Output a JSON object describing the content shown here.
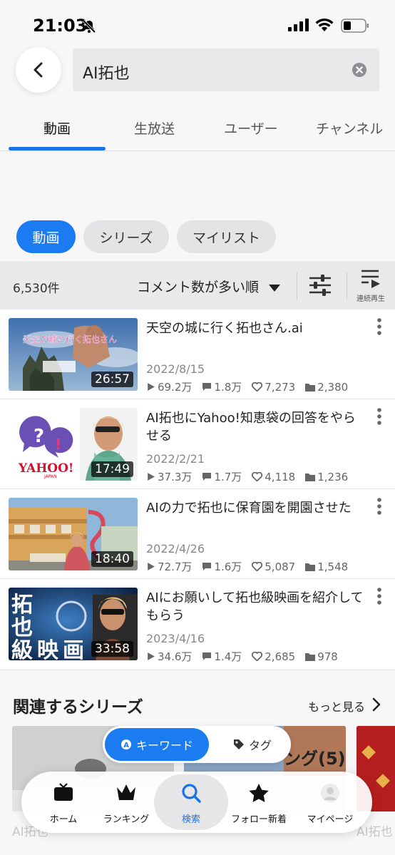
{
  "status_bar": {
    "time": "21:03"
  },
  "search": {
    "query": "AI拓也"
  },
  "tabs": [
    {
      "label": "動画",
      "active": true
    },
    {
      "label": "生放送",
      "active": false
    },
    {
      "label": "ユーザー",
      "active": false
    },
    {
      "label": "チャンネル",
      "active": false
    }
  ],
  "filter_chips": [
    {
      "label": "動画",
      "active": true
    },
    {
      "label": "シリーズ",
      "active": false
    },
    {
      "label": "マイリスト",
      "active": false
    }
  ],
  "sort_bar": {
    "count": "6,530件",
    "sort_label": "コメント数が多い順",
    "continuous_label": "連続再生"
  },
  "videos": [
    {
      "title": "天空の城に行く拓也さん.ai",
      "date": "2022/8/15",
      "duration": "26:57",
      "views": "69.2万",
      "comments": "1.8万",
      "likes": "7,273",
      "mylists": "2,380"
    },
    {
      "title": "AI拓也にYahoo!知恵袋の回答をやらせる",
      "date": "2022/2/21",
      "duration": "17:49",
      "views": "37.3万",
      "comments": "1.7万",
      "likes": "4,118",
      "mylists": "1,236"
    },
    {
      "title": "AIの力で拓也に保育園を開園させた",
      "date": "2022/4/26",
      "duration": "18:40",
      "views": "72.7万",
      "comments": "1.6万",
      "likes": "5,087",
      "mylists": "1,548"
    },
    {
      "title": "AIにお願いして拓也級映画を紹介してもらう",
      "date": "2023/4/16",
      "duration": "33:58",
      "views": "34.6万",
      "comments": "1.4万",
      "likes": "2,685",
      "mylists": "978"
    }
  ],
  "thumb_text": {
    "v1_overlay": "天空の城に行く拓也さん",
    "v2_logo": "YAHOO!",
    "v2_logo_sub": "JAPAN",
    "v4_chars": [
      "拓",
      "也",
      "級",
      "映",
      "画"
    ]
  },
  "related": {
    "title": "関連するシリーズ",
    "more": "もっと見る",
    "cards": [
      {
        "caption": "AI拓也"
      },
      {
        "caption": "ング(5)"
      },
      {
        "caption": "AI拓也"
      }
    ]
  },
  "search_mode": {
    "keyword": "キーワード",
    "tag": "タグ"
  },
  "bottom_nav": [
    {
      "label": "ホーム",
      "icon": "tv-icon",
      "active": false
    },
    {
      "label": "ランキング",
      "icon": "crown-icon",
      "active": false
    },
    {
      "label": "検索",
      "icon": "search-icon",
      "active": true
    },
    {
      "label": "フォロー新着",
      "icon": "star-icon",
      "active": false
    },
    {
      "label": "マイページ",
      "icon": "avatar-icon",
      "active": false
    }
  ],
  "colors": {
    "accent": "#1a7cf0",
    "active_nav_text": "#1a73e8",
    "sort_bar_bg": "#e9e9eb"
  }
}
